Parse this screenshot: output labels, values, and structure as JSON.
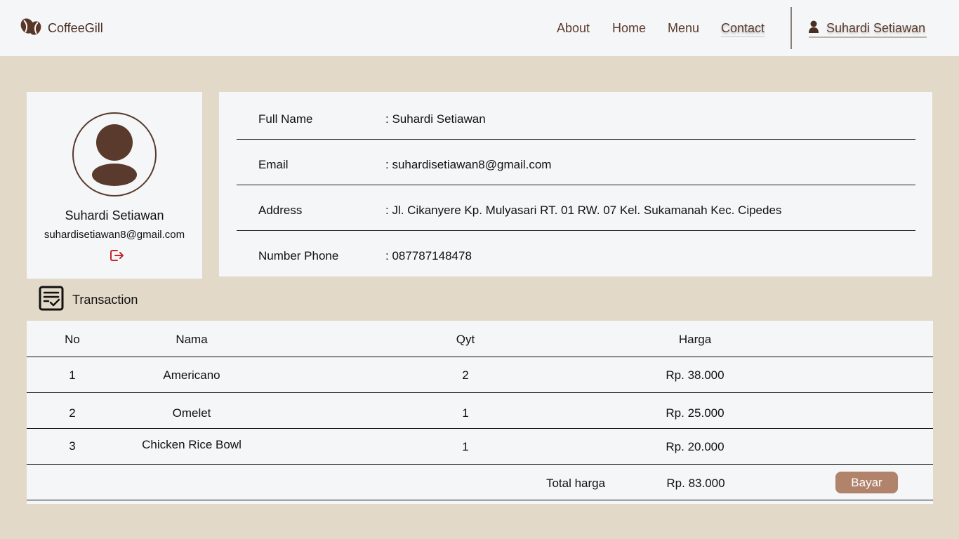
{
  "brand": {
    "name": "CoffeeGill",
    "icon": "coffee-beans-icon"
  },
  "nav": {
    "links": [
      {
        "label": "About"
      },
      {
        "label": "Home"
      },
      {
        "label": "Menu"
      },
      {
        "label": "Contact"
      }
    ],
    "user": {
      "name": "Suhardi Setiawan",
      "icon": "user-icon"
    }
  },
  "profile": {
    "name": "Suhardi Setiawan",
    "email": "suhardisetiawan8@gmail.com",
    "avatar_icon": "avatar-icon",
    "logout_icon": "logout-icon"
  },
  "info": {
    "rows": [
      {
        "label": "Full Name",
        "value": ": Suhardi Setiawan"
      },
      {
        "label": "Email",
        "value": ": suhardisetiawan8@gmail.com"
      },
      {
        "label": "Address",
        "value": ": Jl. Cikanyere Kp. Mulyasari RT. 01 RW. 07 Kel. Sukamanah Kec. Cipedes"
      },
      {
        "label": "Number Phone",
        "value": ": 087787148478"
      }
    ]
  },
  "transaction": {
    "title": "Transaction",
    "icon": "receipt-check-icon",
    "headers": {
      "no": "No",
      "nama": "Nama",
      "qyt": "Qyt",
      "harga": "Harga"
    },
    "rows": [
      {
        "no": "1",
        "nama": "Americano",
        "qyt": "2",
        "harga": "Rp. 38.000"
      },
      {
        "no": "2",
        "nama": "Omelet",
        "qyt": "1",
        "harga": "Rp. 25.000"
      },
      {
        "no": "3",
        "nama": "Chicken Rice Bowl",
        "qyt": "1",
        "harga": "Rp. 20.000"
      }
    ],
    "total_label": "Total harga",
    "total_value": "Rp. 83.000",
    "pay_label": "Bayar"
  },
  "colors": {
    "page_bg": "#E2D9C8",
    "card_bg": "#F4F6F8",
    "brand_brown": "#5C3A2B",
    "pay_button": "#B0836A",
    "logout_red": "#C62828"
  }
}
